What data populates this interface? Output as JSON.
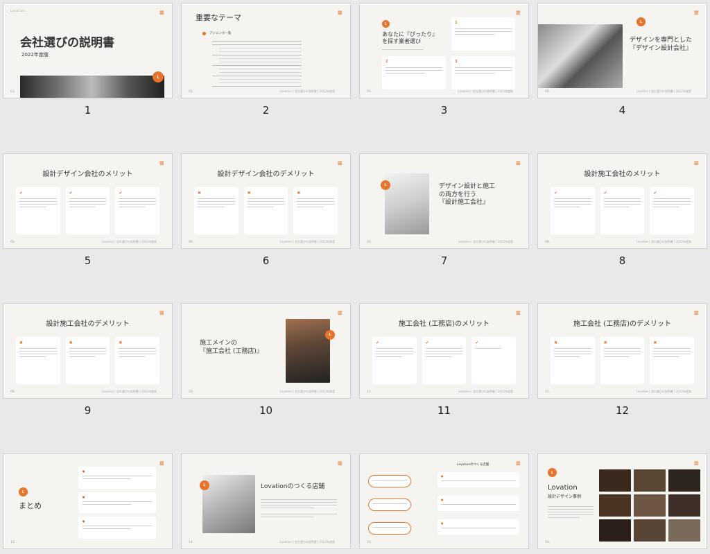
{
  "deck": {
    "footer_text": "Lovation | 会社選びの説明書 | 2022年度版",
    "logo_letter": "L",
    "brand_tiny": "Lovation"
  },
  "slides": [
    {
      "num": "1",
      "page": "01.",
      "title": "会社選びの説明書",
      "subtitle": "2022年度版"
    },
    {
      "num": "2",
      "page": "02.",
      "title": "重要なテーマ",
      "agenda_label": "アジェンダ一覧"
    },
    {
      "num": "3",
      "page": "03.",
      "title_a": "あなたに『ぴったり』",
      "title_b": "を探す業者選び"
    },
    {
      "num": "4",
      "page": "04.",
      "title_a": "デザインを専門とした",
      "title_b": "『デザイン設計会社』"
    },
    {
      "num": "5",
      "page": "05.",
      "title": "設計デザイン会社のメリット",
      "marks": [
        "✔",
        "✔",
        "✔"
      ]
    },
    {
      "num": "6",
      "page": "06.",
      "title": "設計デザイン会社のデメリット",
      "marks": [
        "✖",
        "✖",
        "✖"
      ]
    },
    {
      "num": "7",
      "page": "07.",
      "title_a": "デザイン設計と施工",
      "title_b": "の両方を行う",
      "title_c": "『設計施工会社』"
    },
    {
      "num": "8",
      "page": "08.",
      "title": "設計施工会社のメリット",
      "marks": [
        "✔",
        "✔",
        "✔"
      ]
    },
    {
      "num": "9",
      "page": "09.",
      "title": "設計施工会社のデメリット",
      "marks": [
        "✖",
        "✖",
        "✖"
      ]
    },
    {
      "num": "10",
      "page": "10.",
      "title_a": "施工メインの",
      "title_b": "『施工会社 (工務店)』"
    },
    {
      "num": "11",
      "page": "11.",
      "title": "施工会社 (工務店)のメリット",
      "marks": [
        "✔",
        "✔",
        "✔"
      ]
    },
    {
      "num": "12",
      "page": "12.",
      "title": "施工会社 (工務店)のデメリット",
      "marks": [
        "✖",
        "✖",
        "✖"
      ]
    },
    {
      "num": "13",
      "page": "13.",
      "title": "まとめ"
    },
    {
      "num": "14",
      "page": "14.",
      "title": "Lovationのつくる店舗"
    },
    {
      "num": "15",
      "page": "15.",
      "title": "Lovationのつくる店舗"
    },
    {
      "num": "16",
      "page": "16.",
      "title_a": "Lovation",
      "title_b": "設計デザイン事例"
    }
  ]
}
